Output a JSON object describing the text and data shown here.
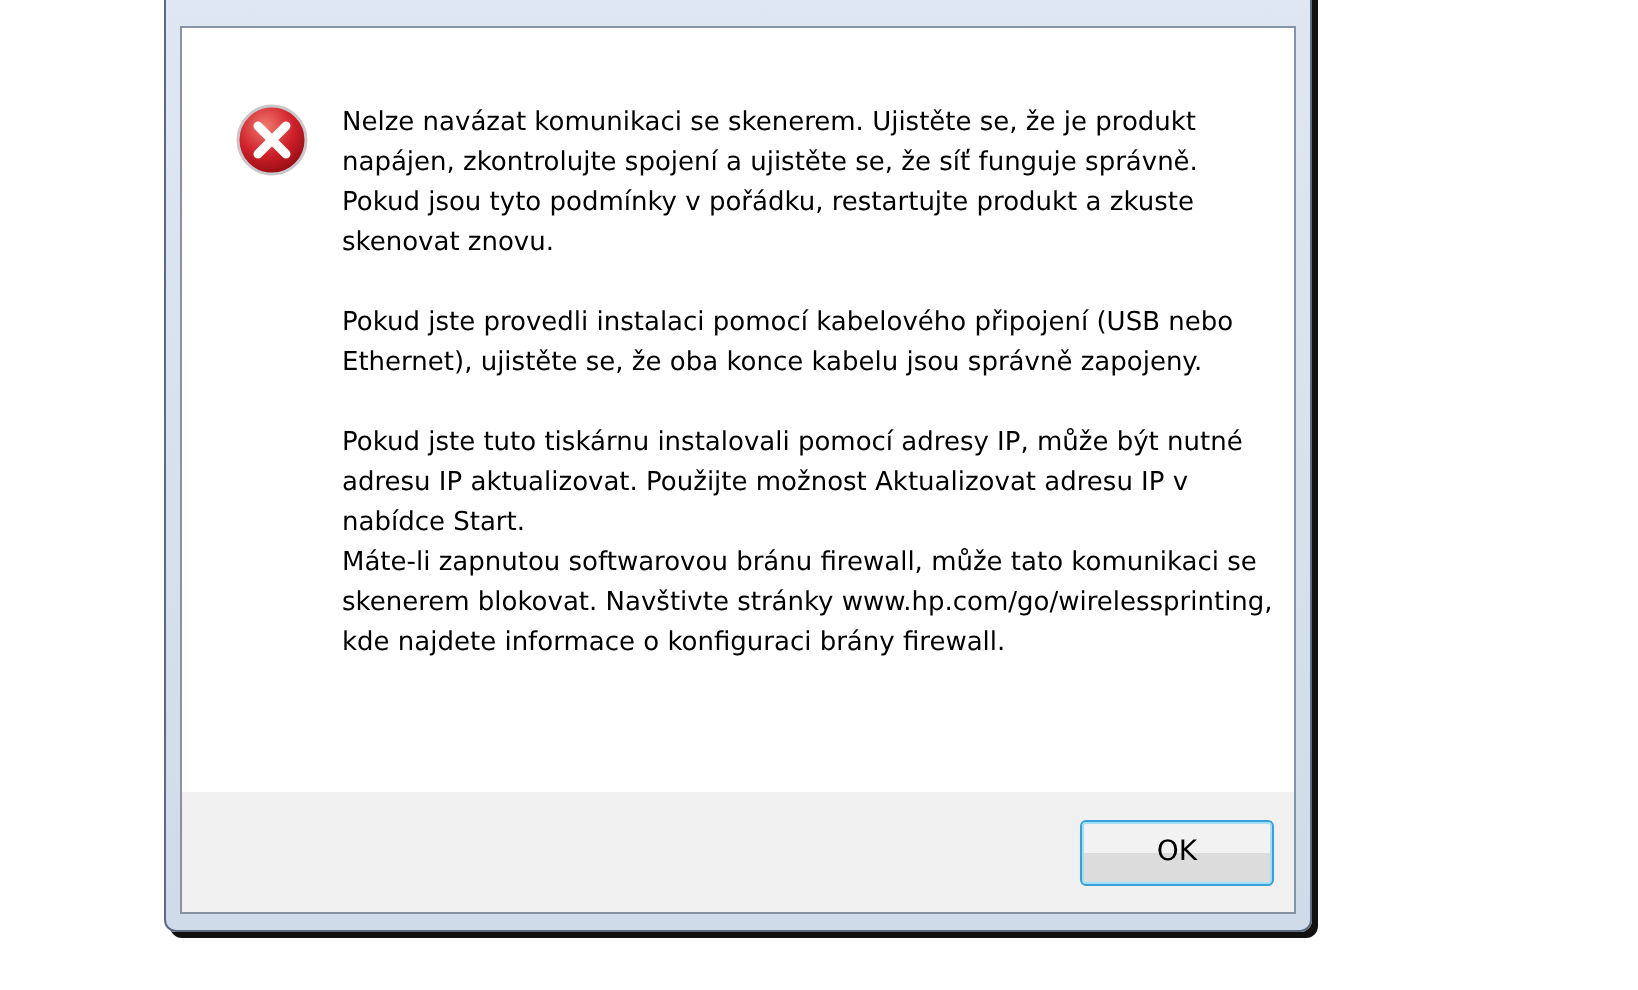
{
  "dialog": {
    "paragraphs": [
      "Nelze navázat komunikaci se skenerem. Ujistěte se, že je produkt napájen, zkontrolujte spojení a ujistěte se, že síť funguje správně. Pokud jsou tyto podmínky v pořádku, restartujte produkt a zkuste skenovat znovu.",
      "Pokud jste provedli instalaci pomocí kabelového připojení (USB nebo Ethernet), ujistěte se, že oba konce kabelu jsou správně zapojeny.",
      "Pokud jste tuto tiskárnu instalovali pomocí adresy IP, může být nutné adresu IP aktualizovat. Použijte možnost Aktualizovat adresu IP v nabídce Start.\nMáte-li zapnutou softwarovou bránu firewall, může tato komunikaci se skenerem blokovat. Navštivte stránky www.hp.com/go/wirelessprinting, kde najdete informace o konfiguraci brány firewall."
    ],
    "buttons": [
      {
        "label": "OK",
        "selected": true
      }
    ]
  }
}
